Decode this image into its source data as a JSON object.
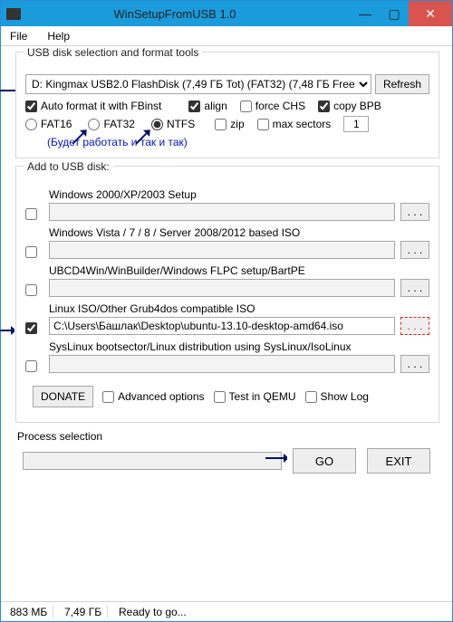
{
  "window": {
    "title": "WinSetupFromUSB 1.0"
  },
  "menu": {
    "file": "File",
    "help": "Help"
  },
  "fs1": {
    "legend": "USB disk selection and format tools",
    "disk": "D: Kingmax USB2.0 FlashDisk (7,49 ГБ Tot) (FAT32) (7,48 ГБ Free",
    "refresh": "Refresh",
    "autofmt": "Auto format it with FBinst",
    "fat16": "FAT16",
    "fat32": "FAT32",
    "ntfs": "NTFS",
    "align": "align",
    "forceCHS": "force CHS",
    "copyBPB": "copy BPB",
    "zip": "zip",
    "maxsec": "max sectors",
    "maxsec_val": "1",
    "hint": "(Будет работать и так и так)"
  },
  "fs2": {
    "legend": "Add to USB disk:",
    "i1": "Windows 2000/XP/2003 Setup",
    "i2": "Windows Vista / 7 / 8 / Server 2008/2012 based ISO",
    "i3": "UBCD4Win/WinBuilder/Windows FLPC setup/BartPE",
    "i4": "Linux ISO/Other Grub4dos compatible ISO",
    "i4_path": "C:\\Users\\Башлак\\Desktop\\ubuntu-13.10-desktop-amd64.iso",
    "i5": "SysLinux bootsector/Linux distribution using SysLinux/IsoLinux",
    "dots": ". . ."
  },
  "opts": {
    "donate": "DONATE",
    "adv": "Advanced options",
    "qemu": "Test in QEMU",
    "log": "Show Log"
  },
  "proc": {
    "label": "Process selection",
    "go": "GO",
    "exit": "EXIT"
  },
  "status": {
    "c1": "883 МБ",
    "c2": "7,49 ГБ",
    "c3": "Ready to go..."
  }
}
